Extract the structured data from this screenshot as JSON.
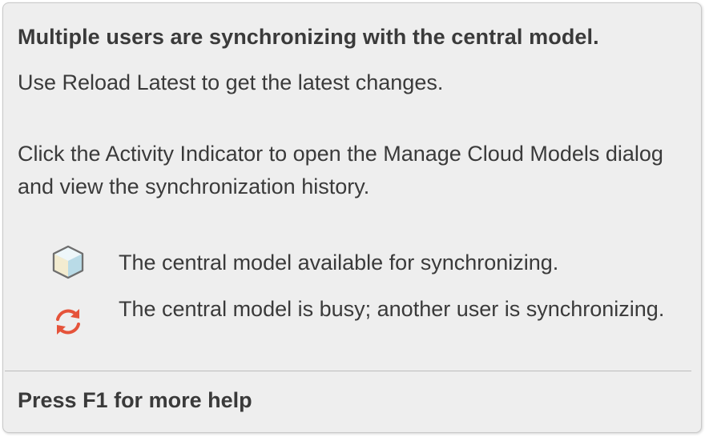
{
  "tooltip": {
    "title": "Multiple users are synchronizing with the central model.",
    "paragraph1": "Use Reload Latest to get the latest changes.",
    "paragraph2": "Click the Activity Indicator to open the Manage Cloud Models dialog and view the synchronization history.",
    "legend": [
      {
        "icon": "cube-icon",
        "text": "The central model available for synchronizing."
      },
      {
        "icon": "sync-busy-icon",
        "text": "The central model is busy; another user is synchronizing."
      }
    ],
    "footer": "Press F1 for more help"
  },
  "colors": {
    "background": "#eeeeee",
    "text": "#3a3a3a",
    "sync_icon": "#e5533a",
    "cube_icon": "#c9e3ee"
  }
}
